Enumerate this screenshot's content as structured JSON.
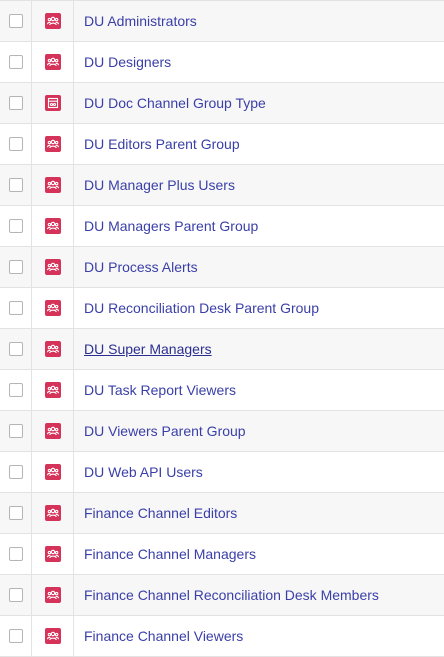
{
  "colors": {
    "icon_background": "#d6335a",
    "link_text": "#3a3fa8",
    "row_alt_background": "#f7f7f7",
    "border": "#e3e3e3"
  },
  "rows": [
    {
      "name": "DU Administrators",
      "icon": "users-group-icon",
      "checked": false
    },
    {
      "name": "DU Designers",
      "icon": "users-group-icon",
      "checked": false
    },
    {
      "name": "DU Doc Channel Group Type",
      "icon": "document-channel-icon",
      "checked": false
    },
    {
      "name": "DU Editors Parent Group",
      "icon": "users-group-icon",
      "checked": false
    },
    {
      "name": "DU Manager Plus Users",
      "icon": "users-group-icon",
      "checked": false
    },
    {
      "name": "DU Managers Parent Group",
      "icon": "users-group-icon",
      "checked": false
    },
    {
      "name": "DU Process Alerts",
      "icon": "users-group-icon",
      "checked": false
    },
    {
      "name": "DU Reconciliation Desk Parent Group",
      "icon": "users-group-icon",
      "checked": false
    },
    {
      "name": "DU Super Managers",
      "icon": "users-group-icon",
      "checked": false,
      "hovered": true
    },
    {
      "name": "DU Task Report Viewers",
      "icon": "users-group-icon",
      "checked": false
    },
    {
      "name": "DU Viewers Parent Group",
      "icon": "users-group-icon",
      "checked": false
    },
    {
      "name": "DU Web API Users",
      "icon": "users-group-icon",
      "checked": false
    },
    {
      "name": "Finance Channel Editors",
      "icon": "users-group-icon",
      "checked": false
    },
    {
      "name": "Finance Channel Managers",
      "icon": "users-group-icon",
      "checked": false
    },
    {
      "name": "Finance Channel Reconciliation Desk Members",
      "icon": "users-group-icon",
      "checked": false
    },
    {
      "name": "Finance Channel Viewers",
      "icon": "users-group-icon",
      "checked": false
    }
  ]
}
